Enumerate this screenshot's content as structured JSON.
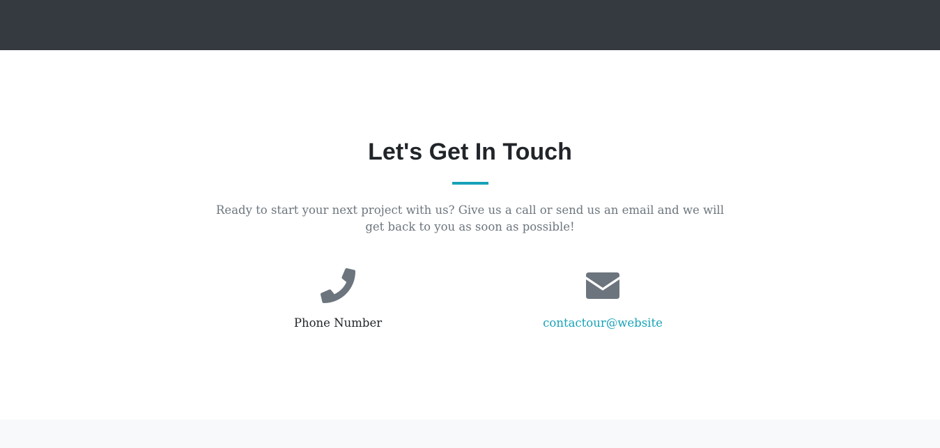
{
  "contact": {
    "title": "Let's Get In Touch",
    "lead": "Ready to start your next project with us? Give us a call or send us an email and we will get back to you as soon as possible!",
    "phone": {
      "icon": "phone-icon",
      "label": "Phone Number"
    },
    "email": {
      "icon": "envelope-icon",
      "link_text": "contactour@website"
    }
  },
  "colors": {
    "navbar": "#343a40",
    "accent": "#17a2b8",
    "heading": "#212529",
    "muted": "#6c757d",
    "icon": "#6c757d",
    "footer_band": "#f8f9fa"
  }
}
